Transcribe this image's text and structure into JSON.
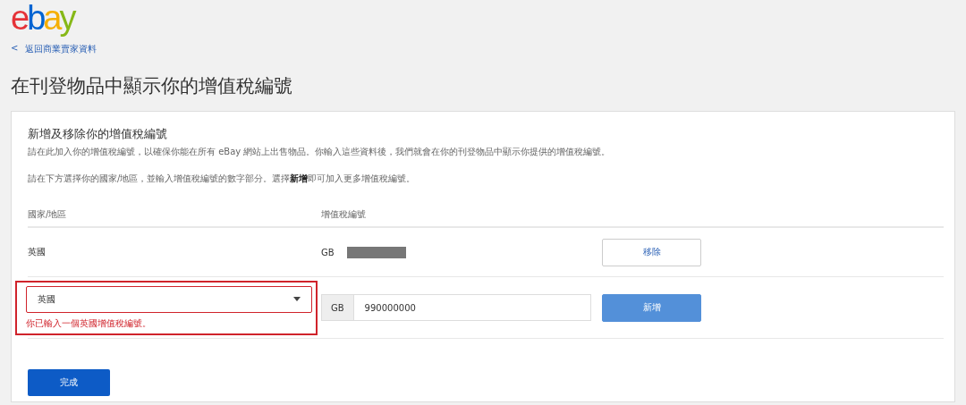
{
  "logo": {
    "letters": [
      {
        "char": "e",
        "color": "#e53238"
      },
      {
        "char": "b",
        "color": "#0064d2"
      },
      {
        "char": "a",
        "color": "#f5af02"
      },
      {
        "char": "y",
        "color": "#86b817"
      }
    ]
  },
  "back_link": {
    "icon": "<",
    "label": "返回商業賣家資料"
  },
  "page_title": "在刊登物品中顯示你的增值稅編號",
  "card": {
    "heading": "新增及移除你的增值稅編號",
    "paragraphs": [
      "請在此加入你的增值稅編號，以確保你能在所有 eBay 網站上出售物品。你輸入這些資料後，我們就會在你的刊登物品中顯示你提供的增值稅編號。",
      "請在下方選擇你的國家/地區，並輸入增值稅編號的數字部分。選擇**新增**即可加入更多增值稅編號。"
    ],
    "columns": [
      "國家/地區",
      "增值稅編號"
    ],
    "rows": [
      {
        "kind": "saved",
        "country": "英國",
        "prefix": "GB",
        "redacted": true,
        "button": "移除"
      },
      {
        "kind": "entry",
        "country": "英國",
        "prefix": "GB",
        "value": "990000000",
        "button": "新增",
        "error": "你已輸入一個英國增值稅編號。"
      }
    ],
    "done_button": "完成"
  }
}
